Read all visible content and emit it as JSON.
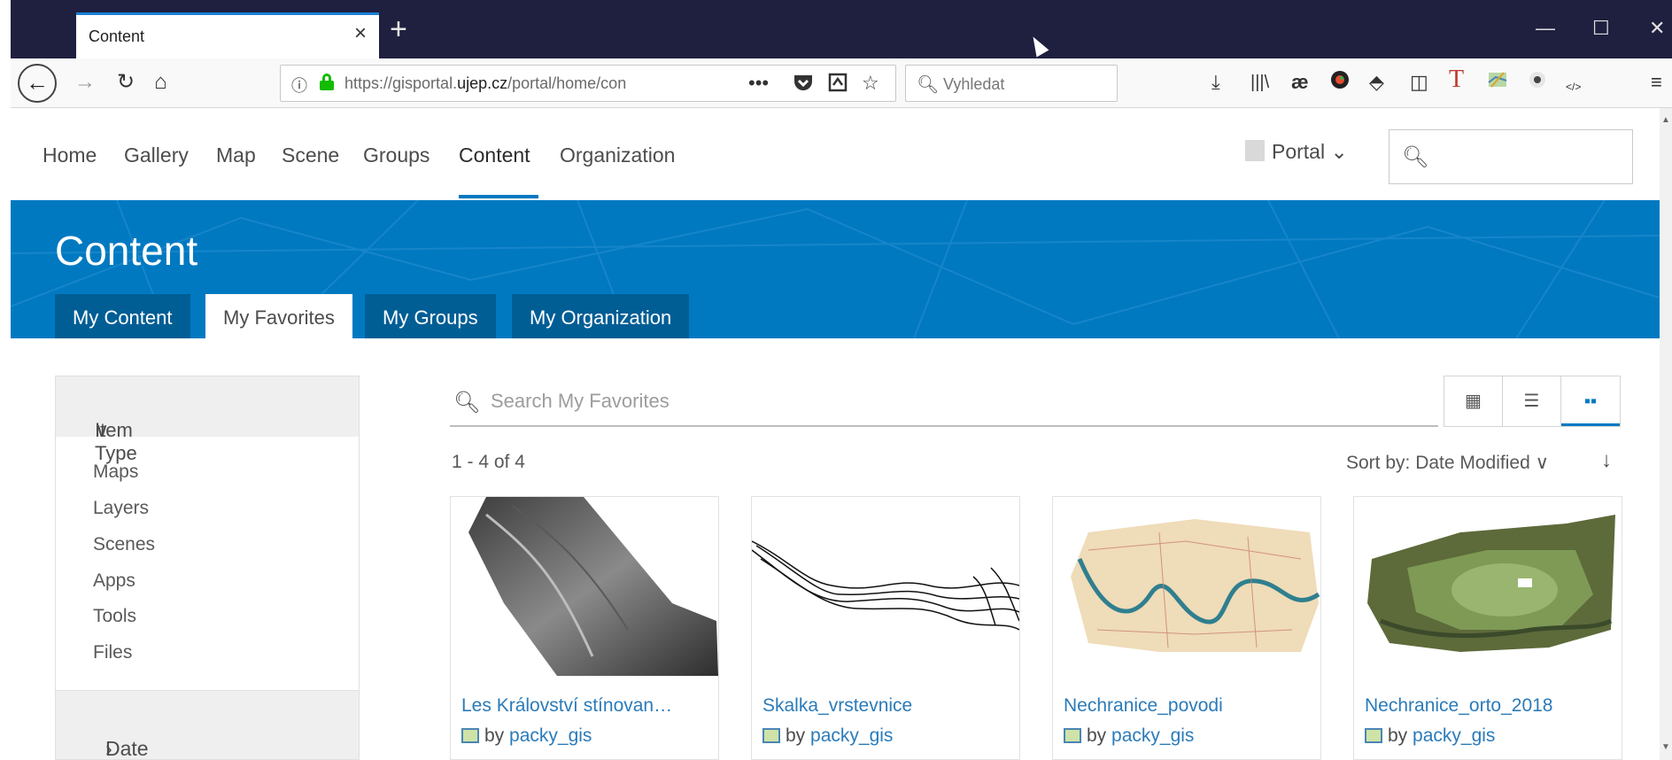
{
  "browser": {
    "tab_title": "Content",
    "tab_close": "×",
    "new_tab": "+",
    "window_controls": {
      "minimize": "—",
      "maximize": "☐",
      "close": "✕"
    },
    "url_prefix": "https://gisportal.",
    "url_domain": "ujep.cz",
    "url_suffix": "/portal/home/con",
    "search_placeholder": "Vyhledat",
    "icons": [
      "back-icon",
      "forward-icon",
      "reload-icon",
      "home-icon",
      "info-icon",
      "lock-icon",
      "page-actions-icon",
      "pocket-icon",
      "reader-icon",
      "bookmark-star-icon",
      "search-icon",
      "download-icon",
      "library-icon",
      "extension-ae-icon",
      "extension-color-icon",
      "extension-arrow-icon",
      "sidebar-icon",
      "extension-t-icon",
      "extension-map-icon",
      "extension-eye-icon",
      "extension-code-icon",
      "menu-icon"
    ]
  },
  "portal": {
    "nav": [
      "Home",
      "Gallery",
      "Map",
      "Scene",
      "Groups",
      "Content",
      "Organization"
    ],
    "active_nav": "Content",
    "user_label": "Portal",
    "banner_title": "Content",
    "content_tabs": [
      "My Content",
      "My Favorites",
      "My Groups",
      "My Organization"
    ],
    "active_tab": "My Favorites",
    "colors": {
      "accent": "#0079c1",
      "banner_tab": "#005e95",
      "link": "#2b7bb9"
    }
  },
  "filters": {
    "item_type_label": "Item Type",
    "item_types": [
      "Maps",
      "Layers",
      "Scenes",
      "Apps",
      "Tools",
      "Files"
    ],
    "date_modified_label": "Date Modified"
  },
  "content": {
    "search_placeholder": "Search My Favorites",
    "result_count": "1 - 4 of 4",
    "sort_label": "Sort by: Date Modified",
    "view_modes": [
      "table",
      "list",
      "grid"
    ],
    "active_view": "grid",
    "items": [
      {
        "title": "Les Království stínovan…",
        "by": "by",
        "owner": "packy_gis",
        "thumb": "grayscale-hillshade"
      },
      {
        "title": "Skalka_vrstevnice",
        "by": "by",
        "owner": "packy_gis",
        "thumb": "contour-lines"
      },
      {
        "title": "Nechranice_povodi",
        "by": "by",
        "owner": "packy_gis",
        "thumb": "historic-map"
      },
      {
        "title": "Nechranice_orto_2018",
        "by": "by",
        "owner": "packy_gis",
        "thumb": "orthophoto"
      }
    ]
  }
}
